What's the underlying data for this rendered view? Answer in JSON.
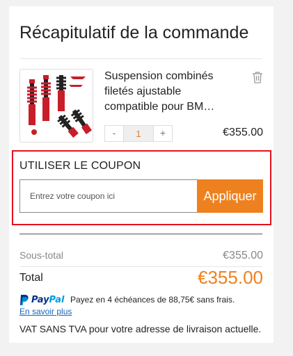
{
  "summary": {
    "title": "Récapitulatif de la commande"
  },
  "item": {
    "name": "Suspension combinés filetés ajustable compatible pour BM…",
    "quantity": "1",
    "decrement_label": "-",
    "increment_label": "+",
    "price": "€355.00"
  },
  "coupon": {
    "label": "UTILISER LE COUPON",
    "placeholder": "Entrez votre coupon ici",
    "apply_label": "Appliquer"
  },
  "totals": {
    "subtotal_label": "Sous-total",
    "subtotal_value": "€355.00",
    "total_label": "Total",
    "total_value": "€355.00"
  },
  "paypal": {
    "brand_pay": "Pay",
    "brand_pal": "Pal",
    "installments_text": "Payez en 4 échéances de 88,75€ sans frais.",
    "learn_more": "En savoir plus"
  },
  "vat_note": "VAT  SANS TVA pour votre adresse de livraison actuelle.",
  "colors": {
    "accent": "#ee811f",
    "highlight_border": "#e5101f",
    "paypal_dark": "#003087",
    "paypal_light": "#009cde",
    "link": "#1565c0"
  },
  "icons": {
    "delete": "trash-icon",
    "paypal": "paypal-logo-icon",
    "product": "product-thumbnail"
  }
}
